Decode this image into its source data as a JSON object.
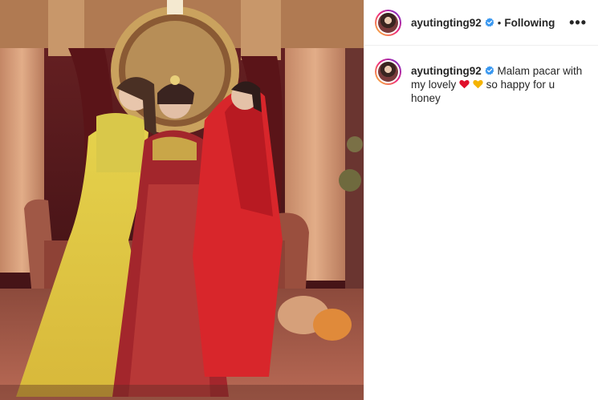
{
  "post": {
    "username": "ayutingting92",
    "follow_status": "Following",
    "separator": "•",
    "more_label": "•••",
    "caption_text_1": "Malam pacar with my lovely",
    "caption_text_2": "so happy for u honey",
    "emoji_1": "red-heart",
    "emoji_2": "yellow-heart"
  },
  "colors": {
    "verified_badge": "#3897f0",
    "red_heart": "#e0102c",
    "yellow_heart": "#f5b400"
  }
}
